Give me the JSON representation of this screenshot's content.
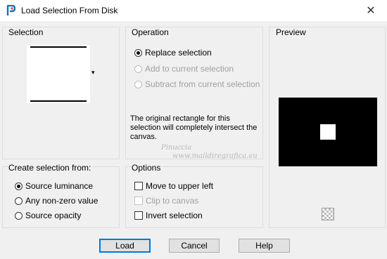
{
  "window": {
    "title": "Load Selection From Disk",
    "close_glyph": "✕"
  },
  "selection": {
    "label": "Selection",
    "dropdown_arrow": "▾"
  },
  "operation": {
    "label": "Operation",
    "options": [
      {
        "label": "Replace selection",
        "selected": true,
        "enabled": true
      },
      {
        "label": "Add to current selection",
        "selected": false,
        "enabled": false
      },
      {
        "label": "Subtract from current selection",
        "selected": false,
        "enabled": false
      }
    ],
    "description": "The original rectangle for this selection will completely intersect the canvas."
  },
  "preview": {
    "label": "Preview",
    "background": "#000000",
    "shape_color": "#ffffff"
  },
  "create_from": {
    "label": "Create selection from:",
    "options": [
      {
        "label": "Source luminance",
        "selected": true
      },
      {
        "label": "Any non-zero value",
        "selected": false
      },
      {
        "label": "Source opacity",
        "selected": false
      }
    ]
  },
  "options": {
    "label": "Options",
    "items": [
      {
        "label": "Move to upper left",
        "checked": false,
        "enabled": true
      },
      {
        "label": "Clip to canvas",
        "checked": false,
        "enabled": false
      },
      {
        "label": "Invert selection",
        "checked": false,
        "enabled": true
      }
    ]
  },
  "buttons": {
    "load": "Load",
    "cancel": "Cancel",
    "help": "Help"
  },
  "watermark": {
    "line1": "Pinuccia",
    "line2": "www.maildiregrafica.eu"
  }
}
